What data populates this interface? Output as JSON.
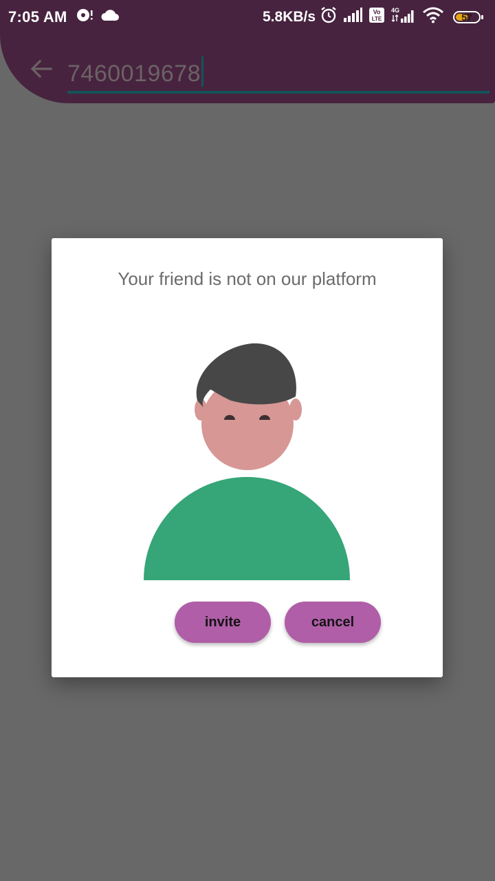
{
  "status_bar": {
    "time": "7:05 AM",
    "network_speed": "5.8KB/s",
    "battery_percent": "57",
    "battery_level": 0.57,
    "left_icons": [
      "media-sync-icon",
      "cloud-icon"
    ],
    "right_icons": [
      "alarm-icon",
      "signal-icon",
      "volte-icon",
      "4g-signal-icon",
      "wifi-icon",
      "battery-icon"
    ],
    "volte_label": "Vo LTE",
    "network_type": "4G"
  },
  "app_bar": {
    "search_value": "7460019678",
    "accent_color": "#14545a",
    "bar_color": "#47233f"
  },
  "dialog": {
    "title": "Your friend is not on our platform",
    "invite_label": "invite",
    "cancel_label": "cancel",
    "button_color": "#b05ea8",
    "illustration": "person-avatar-illustration"
  }
}
